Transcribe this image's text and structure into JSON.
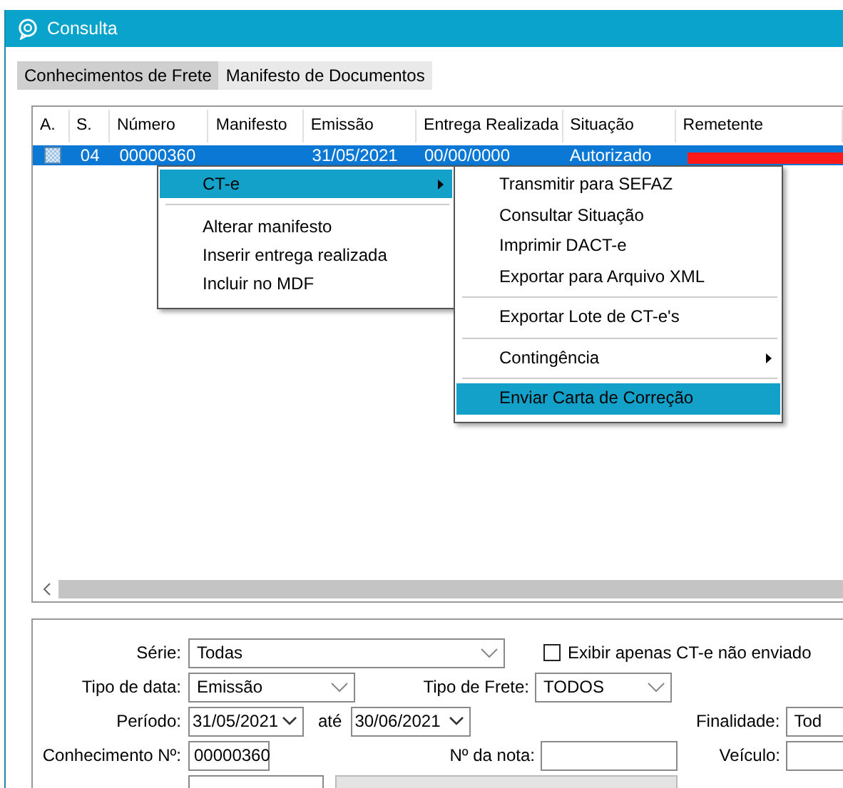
{
  "window": {
    "title": "Consulta"
  },
  "tabs": [
    {
      "label": "Conhecimentos de Frete",
      "selected": true
    },
    {
      "label": "Manifesto de Documentos",
      "selected": false
    }
  ],
  "table": {
    "columns": [
      "A.",
      "S.",
      "Número",
      "Manifesto",
      "Emissão",
      "Entrega Realizada",
      "Situação",
      "Remetente"
    ],
    "rows": [
      {
        "selected": true,
        "serie": "04",
        "numero": "00000360",
        "emissao": "31/05/2021",
        "entrega": "00/00/0000",
        "situacao": "Autorizado",
        "remetente_redacted": true
      }
    ]
  },
  "context_menu": {
    "items": [
      {
        "kind": "item",
        "label": "CT-e",
        "selected": true,
        "submenu": true
      },
      {
        "kind": "separator"
      },
      {
        "kind": "item",
        "label": "Alterar manifesto",
        "selected": false,
        "submenu": false
      },
      {
        "kind": "item",
        "label": "Inserir entrega realizada",
        "selected": false,
        "submenu": false
      },
      {
        "kind": "item",
        "label": "Incluir no MDF",
        "selected": false,
        "submenu": false
      }
    ]
  },
  "submenu": {
    "items": [
      {
        "kind": "item",
        "label": "Transmitir para SEFAZ",
        "selected": false,
        "submenu": false
      },
      {
        "kind": "item",
        "label": "Consultar Situação",
        "selected": false,
        "submenu": false
      },
      {
        "kind": "item",
        "label": "Imprimir DACT-e",
        "selected": false,
        "submenu": false
      },
      {
        "kind": "item",
        "label": "Exportar para Arquivo XML",
        "selected": false,
        "submenu": false
      },
      {
        "kind": "separator"
      },
      {
        "kind": "item",
        "label": "Exportar Lote de CT-e's",
        "selected": false,
        "submenu": false
      },
      {
        "kind": "separator"
      },
      {
        "kind": "item",
        "label": "Contingência",
        "selected": false,
        "submenu": true
      },
      {
        "kind": "separator"
      },
      {
        "kind": "item",
        "label": "Enviar Carta de Correção",
        "selected": true,
        "submenu": false
      }
    ]
  },
  "filters": {
    "serie": {
      "label": "Série:",
      "value": "Todas"
    },
    "only_unsent": {
      "label": "Exibir apenas CT-e não enviado",
      "checked": false
    },
    "tipo_data": {
      "label": "Tipo de data:",
      "value": "Emissão"
    },
    "tipo_frete": {
      "label": "Tipo de Frete:",
      "value": "TODOS"
    },
    "periodo": {
      "label": "Período:",
      "from": "31/05/2021",
      "to_label": "até",
      "to": "30/06/2021"
    },
    "finalidade": {
      "label": "Finalidade:",
      "value": "Tod"
    },
    "conhecimento": {
      "label": "Conhecimento Nº:",
      "value": "00000360"
    },
    "nota": {
      "label": "Nº da nota:"
    },
    "veiculo": {
      "label": "Veículo:"
    }
  }
}
